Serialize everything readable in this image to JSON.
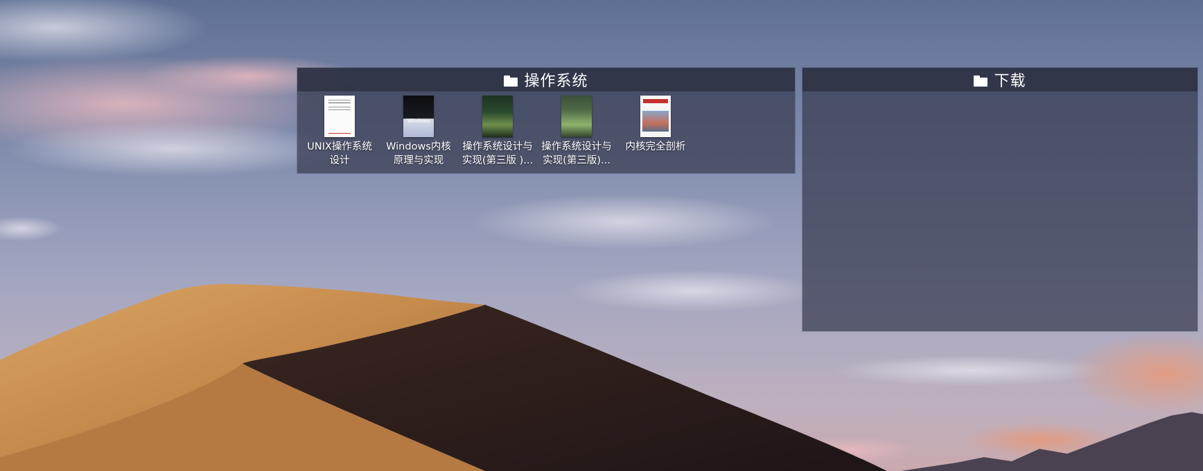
{
  "fences": [
    {
      "title": "操作系统",
      "items": [
        {
          "label": "UNIX操作系统\n设计",
          "cover": "unix"
        },
        {
          "label": "Windows内核\n原理与实现",
          "cover": "windows",
          "cover_text": "Windows"
        },
        {
          "label": "操作系统设计与\n实现(第三版 )...",
          "cover": "os1"
        },
        {
          "label": "操作系统设计与\n实现(第三版)...",
          "cover": "os2"
        },
        {
          "label": "内核完全剖析",
          "cover": "linux"
        }
      ]
    },
    {
      "title": "下载",
      "items": []
    }
  ],
  "colors": {
    "fence_bg": "#383c50",
    "fence_header": "#2e3244",
    "text": "#ffffff"
  }
}
